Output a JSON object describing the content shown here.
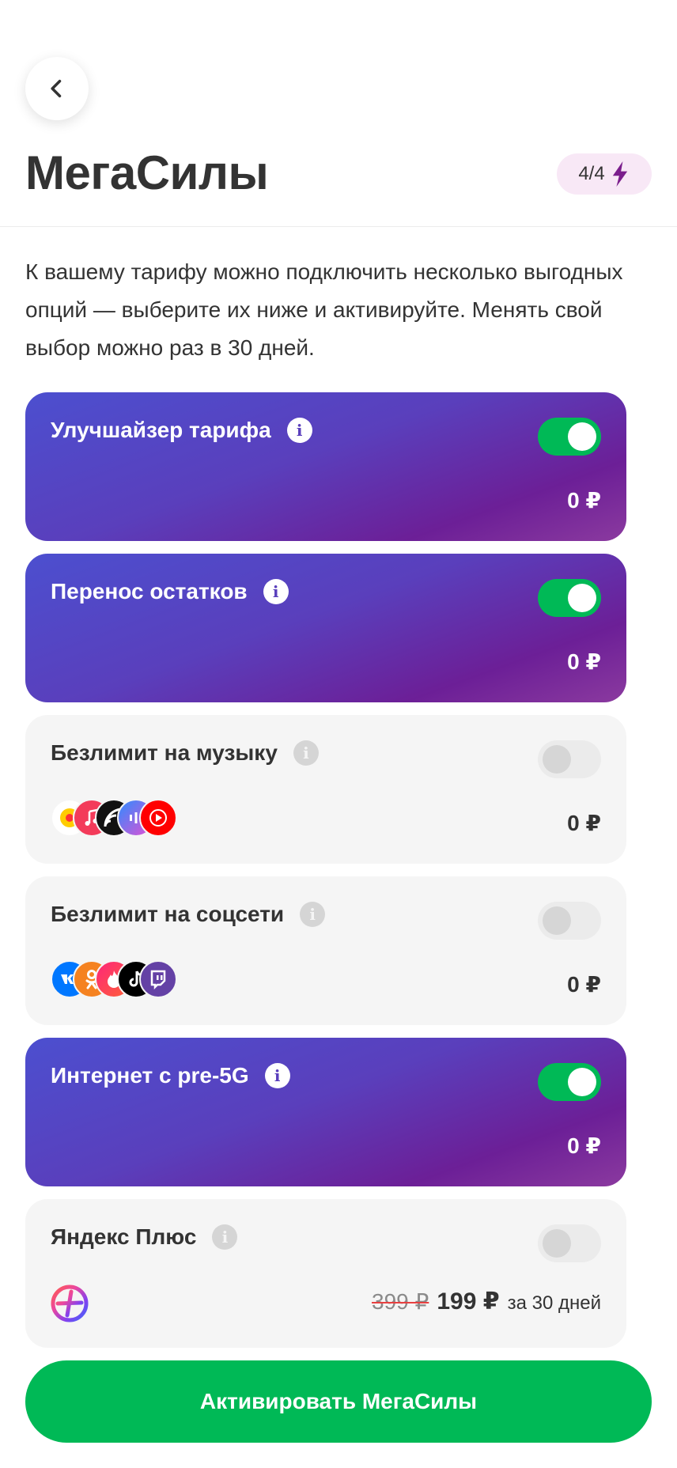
{
  "header": {
    "title": "МегаСилы",
    "badge_count": "4/4"
  },
  "description": "К вашему тарифу можно подключить несколько выгодных опций — выберите их ниже и активируйте. Менять свой выбор можно раз в 30 дней.",
  "options": [
    {
      "title": "Улучшайзер тарифа",
      "price": "0 ₽",
      "enabled": true
    },
    {
      "title": "Перенос остатков",
      "price": "0 ₽",
      "enabled": true
    },
    {
      "title": "Безлимит на музыку",
      "price": "0 ₽",
      "enabled": false,
      "icons": [
        "yandex-music-icon",
        "apple-music-icon",
        "zvuk-icon",
        "vk-music-icon",
        "youtube-music-icon"
      ]
    },
    {
      "title": "Безлимит на соцсети",
      "price": "0 ₽",
      "enabled": false,
      "icons": [
        "vk-icon",
        "ok-icon",
        "tinder-icon",
        "tiktok-icon",
        "twitch-icon"
      ]
    },
    {
      "title": "Интернет с pre-5G",
      "price": "0 ₽",
      "enabled": true
    },
    {
      "title": "Яндекс Плюс",
      "old_price": "399 ₽",
      "new_price": "199 ₽",
      "period": "за 30 дней",
      "enabled": false,
      "icons": [
        "yandex-plus-icon"
      ]
    }
  ],
  "activate_button": "Активировать МегаСилы",
  "colors": {
    "accent_green": "#00b956",
    "card_gradient_start": "#4c4fcf",
    "card_gradient_end": "#6c1f97",
    "badge_bg": "#f8e8f6",
    "bolt": "#7b1e8c"
  }
}
